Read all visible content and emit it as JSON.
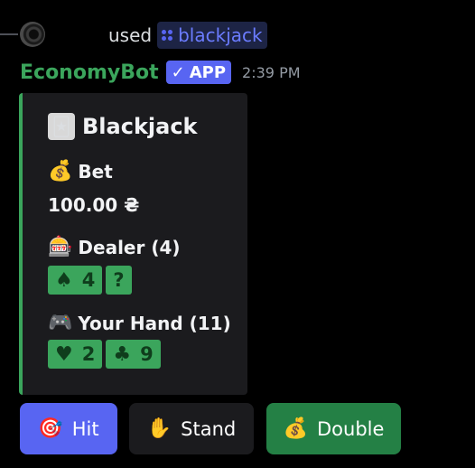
{
  "reply": {
    "used_text": "used",
    "command": "blackjack"
  },
  "message": {
    "author": "EconomyBot",
    "badge": "APP",
    "timestamp": "2:39 PM"
  },
  "embed": {
    "accent_color": "#3ba55c",
    "title_icon": "joker-icon",
    "title": "Blackjack",
    "bet": {
      "label": "Bet",
      "icon": "money-bag-icon",
      "value": "100.00 ₴"
    },
    "dealer": {
      "label": "Dealer (4)",
      "icon": "slot-machine-icon",
      "cards": [
        {
          "suit": "♠",
          "value": "4"
        },
        {
          "suit": "",
          "value": "?"
        }
      ]
    },
    "player": {
      "label": "Your Hand (11)",
      "icon": "game-controller-icon",
      "cards": [
        {
          "suit": "♥",
          "value": "2"
        },
        {
          "suit": "♣",
          "value": "9"
        }
      ]
    }
  },
  "buttons": {
    "hit": {
      "label": "Hit",
      "icon": "dart-icon",
      "color": "#5865f2"
    },
    "stand": {
      "label": "Stand",
      "icon": "raised-hand-icon",
      "color": "#1b1b1e"
    },
    "double": {
      "label": "Double",
      "icon": "money-bag-icon",
      "color": "#248045"
    }
  }
}
